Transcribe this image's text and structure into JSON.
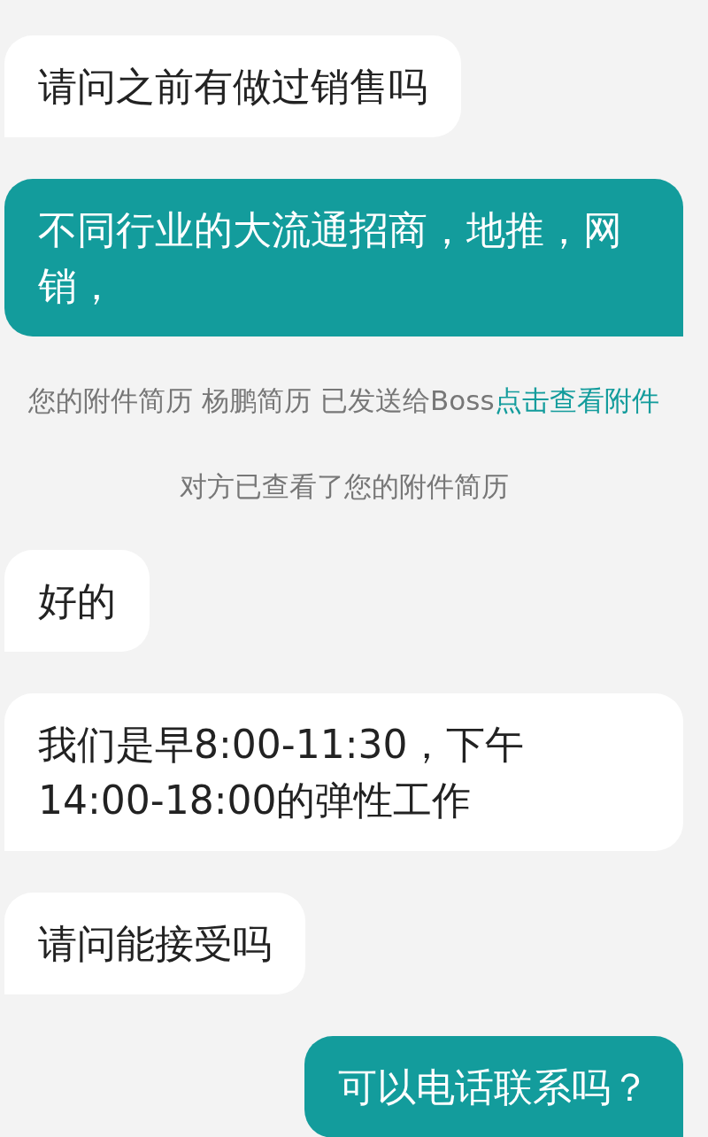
{
  "messages": [
    {
      "kind": "incoming",
      "text": "请问之前有做过销售吗"
    },
    {
      "kind": "outgoing",
      "text": "不同行业的大流通招商，地推，网销，"
    },
    {
      "kind": "system",
      "text": "您的附件简历 杨鹏简历 已发送给Boss",
      "link": "点击查看附件"
    },
    {
      "kind": "system",
      "text": "对方已查看了您的附件简历"
    },
    {
      "kind": "incoming",
      "text": "好的"
    },
    {
      "kind": "incoming",
      "text": "我们是早8:00-11:30，下午14:00-18:00的弹性工作"
    },
    {
      "kind": "incoming",
      "text": "请问能接受吗"
    },
    {
      "kind": "outgoing",
      "text": "可以电话联系吗？"
    }
  ]
}
